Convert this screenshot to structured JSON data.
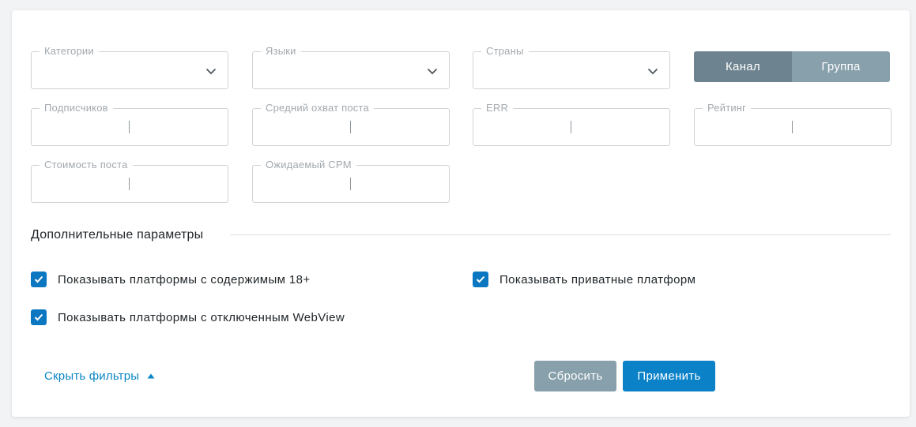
{
  "filters": {
    "categories": {
      "label": "Категории"
    },
    "languages": {
      "label": "Языки"
    },
    "countries": {
      "label": "Страны"
    },
    "subscribers": {
      "label": "Подписчиков"
    },
    "avg_reach": {
      "label": "Средний охват поста"
    },
    "err": {
      "label": "ERR"
    },
    "rating": {
      "label": "Рейтинг"
    },
    "post_cost": {
      "label": "Стоимость поста"
    },
    "expected_cpm": {
      "label": "Ожидаемый CPM"
    }
  },
  "type_toggle": {
    "options": [
      "Канал",
      "Группа"
    ],
    "selected": "Канал"
  },
  "additional": {
    "title": "Дополнительные параметры",
    "options": [
      {
        "label": "Показывать платформы с содержимым 18+",
        "checked": true
      },
      {
        "label": "Показывать приватные платформ",
        "checked": true
      },
      {
        "label": "Показывать платформы с отключенным WebView",
        "checked": true
      }
    ]
  },
  "footer": {
    "hide_filters_label": "Скрыть фильтры",
    "reset_label": "Сбросить",
    "apply_label": "Применить"
  },
  "colors": {
    "accent": "#0b82c8",
    "muted_button": "#88a0ab",
    "toggle_active": "#6d8490",
    "link": "#0b86c6"
  }
}
